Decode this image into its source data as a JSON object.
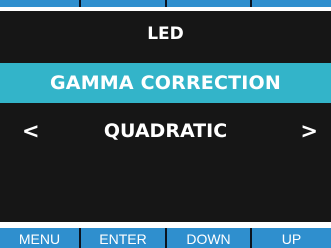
{
  "screen": {
    "title": "LED",
    "setting": "GAMMA CORRECTION",
    "value": "QUADRATIC",
    "prev_arrow": "<",
    "next_arrow": ">"
  },
  "softkeys": [
    {
      "label": "MENU"
    },
    {
      "label": "ENTER"
    },
    {
      "label": "DOWN"
    },
    {
      "label": "UP"
    }
  ],
  "colors": {
    "display_bg": "#161616",
    "highlight": "#33b4c9",
    "softkey_bg": "#2f8fce",
    "text": "#ffffff"
  }
}
